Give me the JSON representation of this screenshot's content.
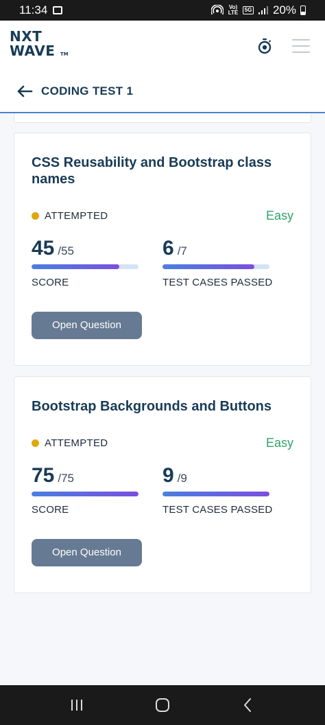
{
  "status_bar": {
    "time": "11:34",
    "network": "5G",
    "volte": "Vo) LTE",
    "battery": "20%"
  },
  "header": {
    "logo_line1": "NXT",
    "logo_line2": "WAVE",
    "logo_tm": "TM"
  },
  "subheader": {
    "title": "CODING TEST 1"
  },
  "questions": [
    {
      "title": "CSS Reusability and Bootstrap class names",
      "status": "ATTEMPTED",
      "difficulty": "Easy",
      "score": "45",
      "score_total": "/55",
      "score_fraction": 0.818,
      "score_label": "SCORE",
      "tests_passed": "6",
      "tests_total": "/7",
      "tests_fraction": 0.857,
      "tests_label": "TEST CASES PASSED",
      "button_label": "Open Question"
    },
    {
      "title": "Bootstrap Backgrounds and Buttons",
      "status": "ATTEMPTED",
      "difficulty": "Easy",
      "score": "75",
      "score_total": "/75",
      "score_fraction": 1.0,
      "score_label": "SCORE",
      "tests_passed": "9",
      "tests_total": "/9",
      "tests_fraction": 1.0,
      "tests_label": "TEST CASES PASSED",
      "button_label": "Open Question"
    }
  ],
  "colors": {
    "primary_text": "#183b56",
    "easy": "#2fa36b",
    "attempted_dot": "#e0a80f",
    "button": "#667a93"
  }
}
